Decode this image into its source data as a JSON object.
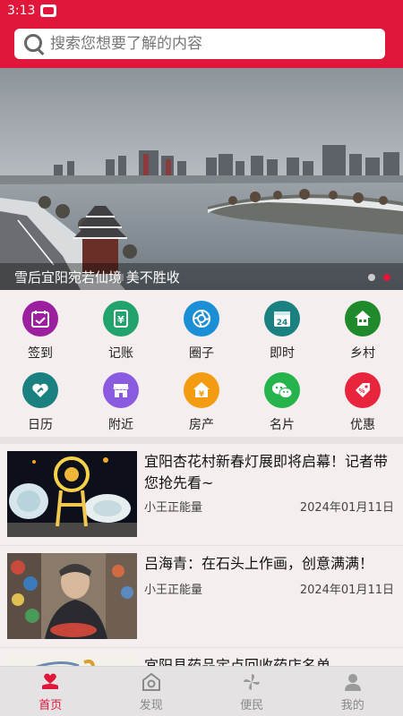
{
  "status_bar": {
    "time": "3:13"
  },
  "search": {
    "placeholder": "搜索您想要了解的内容"
  },
  "banner": {
    "caption": "雪后宜阳宛若仙境 美不胜收",
    "slide_count": 2,
    "active_slide": 2
  },
  "grid": {
    "items": [
      {
        "label": "签到",
        "icon": "calendar-check-icon",
        "color": "#9c1fa0"
      },
      {
        "label": "记账",
        "icon": "yen-ledger-icon",
        "color": "#22a36c"
      },
      {
        "label": "圈子",
        "icon": "aperture-icon",
        "color": "#1b8fd6"
      },
      {
        "label": "即时",
        "icon": "clock-24-icon",
        "color": "#1b8080"
      },
      {
        "label": "乡村",
        "icon": "village-house-icon",
        "color": "#1f8a2c"
      },
      {
        "label": "日历",
        "icon": "heart-hand-icon",
        "color": "#1b8080"
      },
      {
        "label": "附近",
        "icon": "shop-icon",
        "color": "#8a5ae0"
      },
      {
        "label": "房产",
        "icon": "yen-house-icon",
        "color": "#f39c12"
      },
      {
        "label": "名片",
        "icon": "wechat-icon",
        "color": "#25b34b"
      },
      {
        "label": "优惠",
        "icon": "discount-tag-icon",
        "color": "#e8253d"
      }
    ]
  },
  "news": [
    {
      "title": "宜阳杏花村新春灯展即将启幕！记者带您抢先看~",
      "author": "小王正能量",
      "date": "2024年01月11日"
    },
    {
      "title": "吕海青：在石头上作画，创意满满！",
      "author": "小王正能量",
      "date": "2024年01月11日"
    },
    {
      "title": "宜阳县药品定点回收药店名单",
      "author": "",
      "date": ""
    }
  ],
  "tabbar": {
    "tabs": [
      {
        "label": "首页",
        "icon": "home-icon",
        "active": true
      },
      {
        "label": "发现",
        "icon": "discover-icon",
        "active": false
      },
      {
        "label": "便民",
        "icon": "pinwheel-icon",
        "active": false
      },
      {
        "label": "我的",
        "icon": "user-icon",
        "active": false
      }
    ]
  },
  "colors": {
    "brand": "#e0173b",
    "tab_inactive": "#888888"
  }
}
